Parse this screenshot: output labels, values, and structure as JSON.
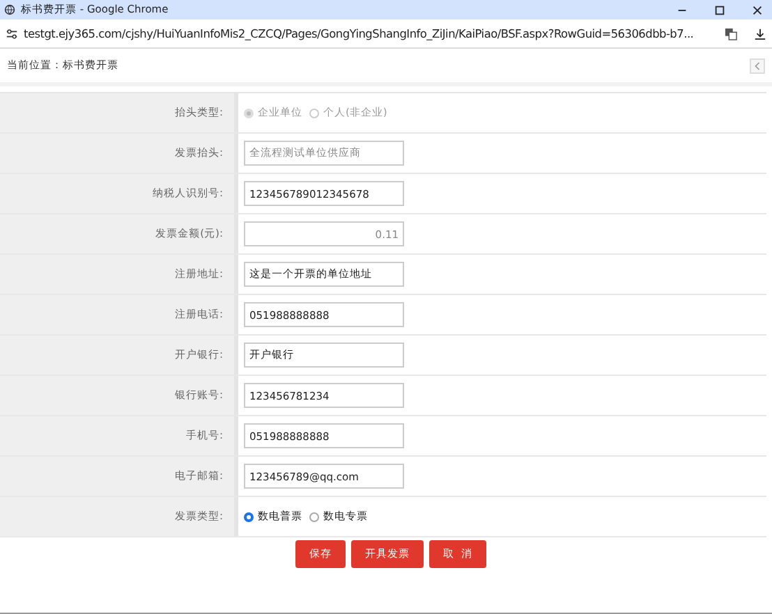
{
  "window": {
    "title": "标书费开票 - Google Chrome"
  },
  "address_bar": {
    "url": "testgt.ejy365.com/cjshy/HuiYuanInfoMis2_CZCQ/Pages/GongYingShangInfo_ZiJin/KaiPiao/BSF.aspx?RowGuid=56306dbb-b7..."
  },
  "breadcrumb": {
    "label": "当前位置：",
    "page": "标书费开票"
  },
  "form": {
    "rows": [
      {
        "label": "抬头类型:",
        "kind": "radio",
        "disabled": true,
        "options": [
          {
            "label": "企业单位",
            "selected": true
          },
          {
            "label": "个人(非企业)",
            "selected": false
          }
        ]
      },
      {
        "label": "发票抬头:",
        "kind": "text",
        "disabled": true,
        "value": "全流程测试单位供应商"
      },
      {
        "label": "纳税人识别号:",
        "kind": "text",
        "disabled": false,
        "value": "123456789012345678"
      },
      {
        "label": "发票金额(元):",
        "kind": "amount",
        "disabled": true,
        "value": "0.11"
      },
      {
        "label": "注册地址:",
        "kind": "text",
        "disabled": false,
        "value": "这是一个开票的单位地址"
      },
      {
        "label": "注册电话:",
        "kind": "text",
        "disabled": false,
        "value": "051988888888"
      },
      {
        "label": "开户银行:",
        "kind": "text",
        "disabled": false,
        "value": "开户银行"
      },
      {
        "label": "银行账号:",
        "kind": "text",
        "disabled": false,
        "value": "123456781234"
      },
      {
        "label": "手机号:",
        "kind": "text",
        "disabled": false,
        "value": "051988888888"
      },
      {
        "label": "电子邮箱:",
        "kind": "text",
        "disabled": false,
        "value": "123456789@qq.com"
      },
      {
        "label": "发票类型:",
        "kind": "radio",
        "disabled": false,
        "options": [
          {
            "label": "数电普票",
            "selected": true
          },
          {
            "label": "数电专票",
            "selected": false
          }
        ]
      }
    ]
  },
  "buttons": [
    "保存",
    "开具发票",
    "取  消"
  ]
}
